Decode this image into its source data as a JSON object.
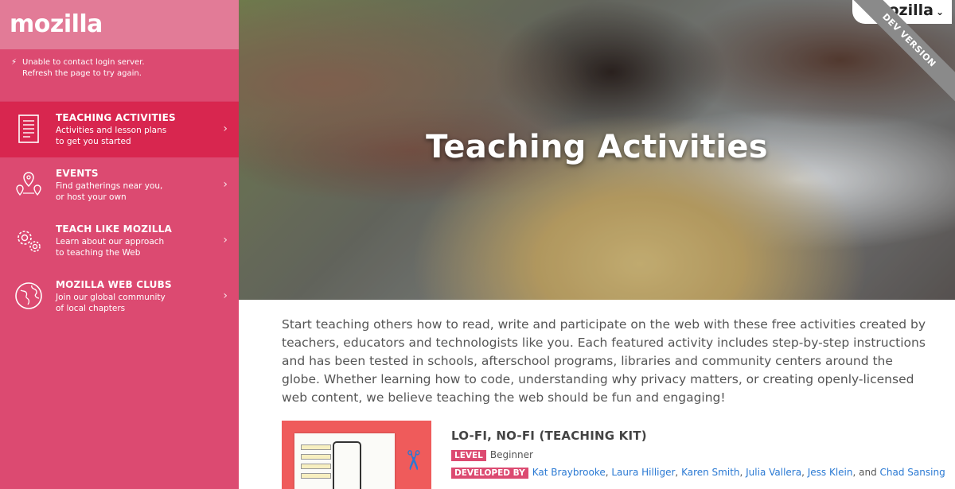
{
  "sidebar": {
    "logo": "mozilla",
    "notice_line1": "Unable to contact login server.",
    "notice_line2": "Refresh the page to try again.",
    "items": [
      {
        "title": "Teaching Activities",
        "desc1": "Activities and lesson plans",
        "desc2": "to get you started",
        "icon": "document-icon",
        "active": true
      },
      {
        "title": "Events",
        "desc1": "Find gatherings near you,",
        "desc2": "or host your own",
        "icon": "map-pins-icon",
        "active": false
      },
      {
        "title": "Teach Like Mozilla",
        "desc1": "Learn about our approach",
        "desc2": "to teaching the Web",
        "icon": "gears-icon",
        "active": false
      },
      {
        "title": "Mozilla Web Clubs",
        "desc1": "Join our global community",
        "desc2": "of local chapters",
        "icon": "globe-icon",
        "active": false
      }
    ]
  },
  "header": {
    "account_logo": "mozilla",
    "ribbon": "DEV VERSION"
  },
  "hero": {
    "title": "Teaching Activities"
  },
  "intro": "Start teaching others how to read, write and participate on the web with these free activities created by teachers, educators and technologists like you. Each featured activity includes step-by-step instructions and has been tested in schools, afterschool programs, libraries and community centers around the globe. Whether learning how to code, understanding why privacy matters, or creating openly-licensed web content, we believe teaching the web should be fun and engaging!",
  "activity": {
    "title": "LO-FI, NO-FI (TEACHING KIT)",
    "level_label": "Level",
    "level_value": "Beginner",
    "developed_label": "Developed by",
    "authors": [
      "Kat Braybrooke",
      "Laura Hilliger",
      "Karen Smith",
      "Julia Vallera",
      "Jess Klein",
      "Chad Sansing"
    ],
    "sep": ", ",
    "and": ", and "
  },
  "colors": {
    "sidebar": "#dc4a71",
    "sidebar_active": "#d8264f",
    "accent_link": "#2a79d3"
  }
}
